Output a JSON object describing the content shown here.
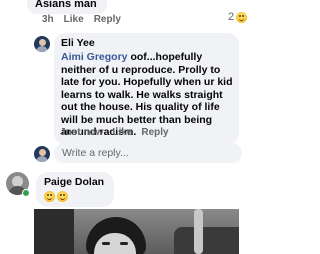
{
  "top_comment": {
    "text_fragment": "Asians man",
    "time": "3h",
    "like_label": "Like",
    "reply_label": "Reply",
    "reaction_count": "2"
  },
  "reply": {
    "author": "Eli Yee",
    "mention": "Aimi Gregory",
    "text": " oof...hopefully neither of u reproduce. Prolly to late for you. Hopefully when ur kid learns to walk. He walks straight out the house. His quality of life will be much better than being around racism.",
    "time": "Just now",
    "like_label": "Like",
    "reply_label": "Reply"
  },
  "reply_input": {
    "placeholder": "Write a reply..."
  },
  "next_comment": {
    "author": "Paige Dolan",
    "emoji_count_shown": 2,
    "online": true
  },
  "icons": {
    "reaction": "haha-emoji-icon",
    "online": "online-status-icon"
  },
  "colors": {
    "bubble": "#f0f2f5",
    "mention": "#385898",
    "meta_text": "#65676b",
    "online": "#31a24c"
  }
}
